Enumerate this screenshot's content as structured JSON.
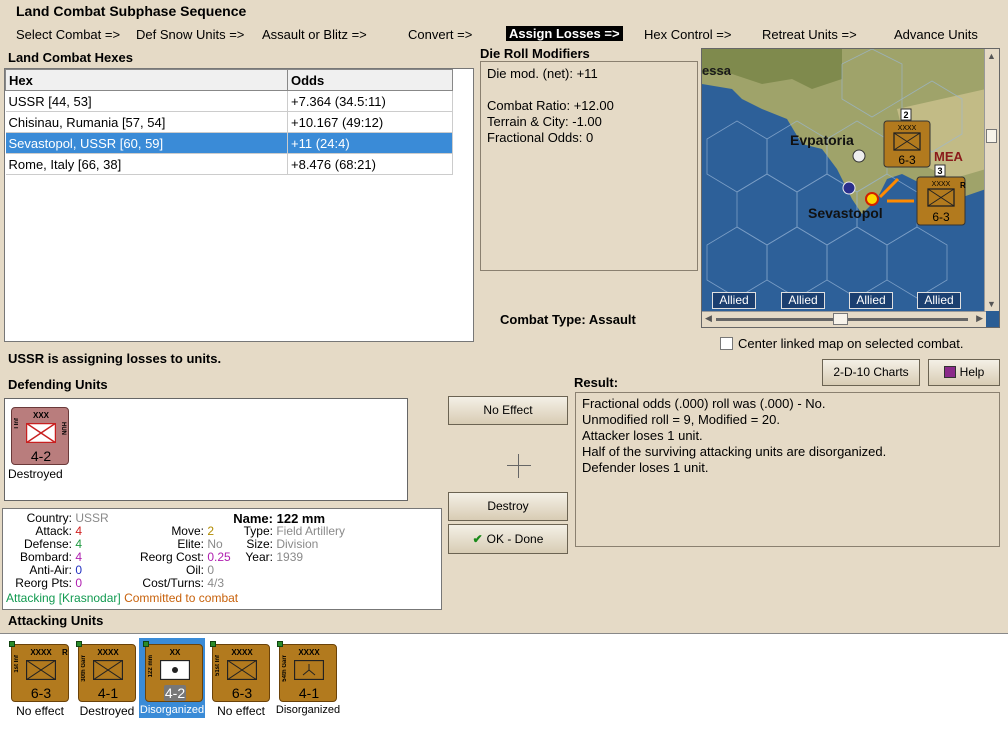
{
  "title": "Land Combat Subphase Sequence",
  "phases": [
    {
      "label": "Select Combat =>",
      "active": false
    },
    {
      "label": "Def Snow Units =>",
      "active": false
    },
    {
      "label": "Assault or Blitz =>",
      "active": false
    },
    {
      "label": "Convert =>",
      "active": false
    },
    {
      "label": "Assign Losses =>",
      "active": true
    },
    {
      "label": "Hex Control =>",
      "active": false
    },
    {
      "label": "Retreat Units =>",
      "active": false
    },
    {
      "label": "Advance Units",
      "active": false
    }
  ],
  "hex_table": {
    "label": "Land Combat Hexes",
    "columns": [
      "Hex",
      "Odds"
    ],
    "rows": [
      {
        "hex": "USSR [44, 53]",
        "odds": "+7.364 (34.5:11)"
      },
      {
        "hex": "Chisinau, Rumania [57, 54]",
        "odds": "+10.167 (49:12)"
      },
      {
        "hex": "Sevastopol, USSR [60, 59]",
        "odds": "+11 (24:4)"
      },
      {
        "hex": "Rome, Italy [66, 38]",
        "odds": "+8.476 (68:21)"
      }
    ]
  },
  "die_roll": {
    "label": "Die Roll Modifiers",
    "net": "Die mod. (net): +11",
    "combat_ratio": "Combat Ratio: +12.00",
    "terrain": "Terrain & City: -1.00",
    "fractional": "Fractional Odds: 0"
  },
  "map": {
    "labels": [
      "essa",
      "Evpatoria",
      "Sevastopol",
      "MEA"
    ],
    "stack_counts": [
      "2",
      "3"
    ],
    "counter_value": "6-3",
    "counter_size": "XXXX",
    "counter_reserve": "R",
    "allied_labels": [
      "Allied",
      "Allied",
      "Allied",
      "Allied"
    ]
  },
  "combat_type": {
    "label": "Combat Type:",
    "value": "Assault"
  },
  "center_linked": "Center linked map on selected combat.",
  "charts_button": "2-D-10 Charts",
  "help_button": "Help",
  "status": "USSR is assigning losses to units.",
  "defending": {
    "label": "Defending Units",
    "units": [
      {
        "size": "XXX",
        "side": "I Inf",
        "nation": "HUN",
        "value": "4-2",
        "caption": "Destroyed"
      }
    ]
  },
  "buttons": {
    "no_effect": "No Effect",
    "destroy": "Destroy",
    "ok": "OK - Done"
  },
  "result": {
    "label": "Result:",
    "lines": [
      "Fractional odds (.000) roll was (.000)  - No.",
      "Unmodified roll = 9, Modified = 20.",
      "Attacker loses 1 unit.",
      "Half of the surviving attacking units are disorganized.",
      "Defender loses 1 unit."
    ]
  },
  "unit_info": {
    "country_label": "Country:",
    "country": "USSR",
    "attack_label": "Attack:",
    "attack": "4",
    "defense_label": "Defense:",
    "defense": "4",
    "bombard_label": "Bombard:",
    "bombard": "4",
    "antiair_label": "Anti-Air:",
    "antiair": "0",
    "reorg_pts_label": "Reorg Pts:",
    "reorg_pts": "0",
    "move_label": "Move:",
    "move": "2",
    "elite_label": "Elite:",
    "elite": "No",
    "reorg_cost_label": "Reorg Cost:",
    "reorg_cost": "0.25",
    "oil_label": "Oil:",
    "oil": "0",
    "cost_turns_label": "Cost/Turns:",
    "cost_turns": "4/3",
    "name_label": "Name:",
    "name": "122 mm",
    "type_label": "Type:",
    "type": "Field Artillery",
    "size_label": "Size:",
    "size": "Division",
    "year_label": "Year:",
    "year": "1939",
    "attacking": "Attacking [Krasnodar]",
    "committed": "Committed to combat",
    "colors": {
      "attack": "#d02020",
      "defense": "#1f9a40",
      "bombard": "#b020b0",
      "antiair": "#2030c0",
      "move": "#b08a00",
      "reorg_cost": "#b020b0",
      "attacking": "#119a50",
      "committed": "#c8620c"
    }
  },
  "attacking": {
    "label": "Attacking Units",
    "units": [
      {
        "size": "XXXX",
        "side": "1st Inf",
        "reserve": "R",
        "value": "6-3",
        "caption": "No effect",
        "selected": false
      },
      {
        "size": "XXXX",
        "side": "30th Garr",
        "reserve": "",
        "value": "4-1",
        "caption": "Destroyed",
        "selected": false
      },
      {
        "size": "XX",
        "side": "122 mm",
        "reserve": "",
        "value": "4-2",
        "caption": "Disorganized",
        "selected": true
      },
      {
        "size": "XXXX",
        "side": "51st Inf",
        "reserve": "",
        "value": "6-3",
        "caption": "No effect",
        "selected": false
      },
      {
        "size": "XXXX",
        "side": "54th Garr",
        "reserve": "",
        "value": "4-1",
        "caption": "Disorganized",
        "selected": false
      }
    ]
  }
}
